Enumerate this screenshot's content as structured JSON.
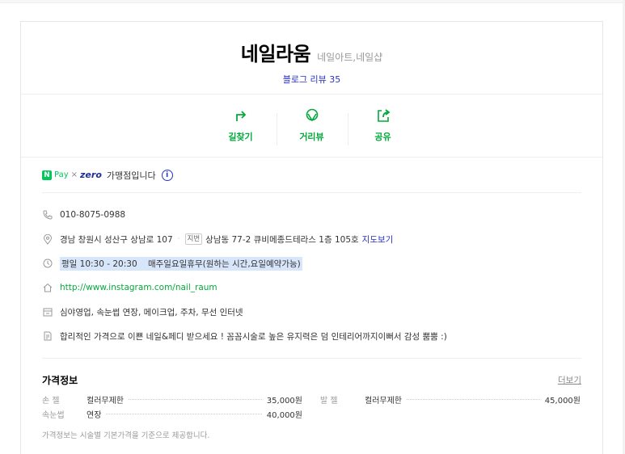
{
  "place": {
    "name": "네일라움",
    "category": "네일아트,네일샵",
    "blog_review": "블로그 리뷰 35"
  },
  "actions": [
    {
      "label": "길찾기",
      "icon": "directions-icon"
    },
    {
      "label": "거리뷰",
      "icon": "streetview-icon"
    },
    {
      "label": "공유",
      "icon": "share-icon"
    }
  ],
  "npay": {
    "n": "N",
    "pay": "Pay",
    "x": "×",
    "zero": "zero",
    "text": "가맹점입니다",
    "info": "i"
  },
  "info": {
    "phone": "010-8075-0988",
    "address": "경남 창원시 성산구 상남로 107",
    "jibun_chip": "지번",
    "jibun": "상남동 77-2 큐비메종드테라스 1층 105호",
    "map_link": "지도보기",
    "hours": "평일 10:30 - 20:30    매주일요일휴무(원하는 시간,요일예약가능)",
    "homepage": "http://www.instagram.com/nail_raum",
    "amenities": "심야영업, 속눈썹 연장, 메이크업, 주차, 무선 인터넷",
    "description": "합리적인 가격으로 이쁜 네일&페디 받으세요 ! 꼼꼼시술로 높은 유지력은 덤 인테리어까지이뻐서 감성 뿜뿜 :)"
  },
  "price": {
    "title": "가격정보",
    "more": "더보기",
    "left": [
      {
        "category": "손 젤",
        "name": "컬러무제한",
        "value": "35,000원"
      },
      {
        "category": "속눈썹",
        "name": "연장",
        "value": "40,000원"
      }
    ],
    "right": [
      {
        "category": "발 젤",
        "name": "컬러무제한",
        "value": "45,000원"
      }
    ],
    "note": "가격정보는 시술별 기본가격을 기준으로 제공합니다."
  },
  "colors": {
    "accent_green": "#03aa3b",
    "link_blue": "#2832c7",
    "hours_highlight": "#d8e6fb"
  }
}
